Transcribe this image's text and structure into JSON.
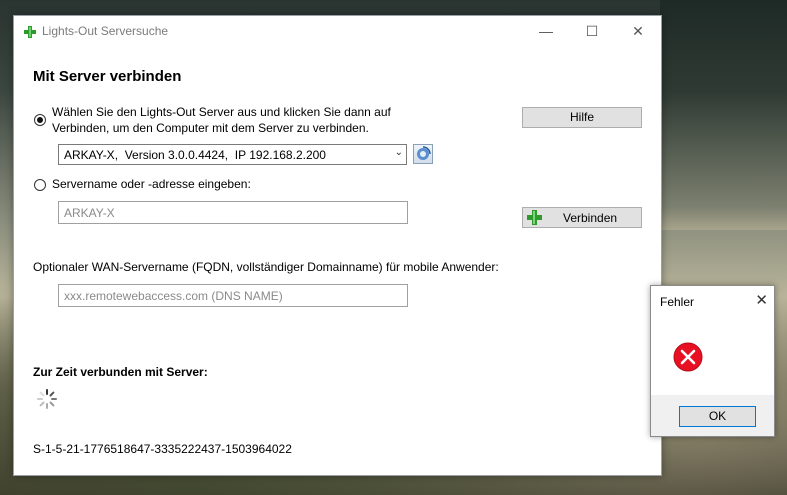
{
  "window": {
    "title": "Lights-Out Serversuche",
    "minimize": "—",
    "maximize": "☐",
    "close": "✕"
  },
  "main": {
    "heading": "Mit Server verbinden",
    "option_select": {
      "line1": "Wählen Sie den Lights-Out Server aus und klicken Sie dann auf",
      "line2": "Verbinden, um den Computer mit dem Server zu verbinden.",
      "selected": true
    },
    "server_combo": {
      "value": "ARKAY-X,  Version 3.0.0.4424,  IP 192.168.2.200",
      "arrow": "⌄"
    },
    "help_button": "Hilfe",
    "option_manual": {
      "label": "Servername oder -adresse eingeben:",
      "selected": false
    },
    "server_name_input": {
      "placeholder": "ARKAY-X"
    },
    "connect_button": "Verbinden",
    "wan_label": "Optionaler WAN-Servername (FQDN, vollständiger Domainname)  für mobile Anwender:",
    "wan_input": {
      "placeholder": "xxx.remotewebaccess.com (DNS NAME)"
    },
    "connected_label": "Zur Zeit verbunden mit Server:",
    "sid": "S-1-5-21-1776518647-3335222437-1503964022"
  },
  "error_dialog": {
    "title": "Fehler",
    "close": "✕",
    "ok_button": "OK"
  },
  "colors": {
    "accent": "#0078d7",
    "error_red": "#e81123",
    "plus_green": "#2e9a2e"
  }
}
